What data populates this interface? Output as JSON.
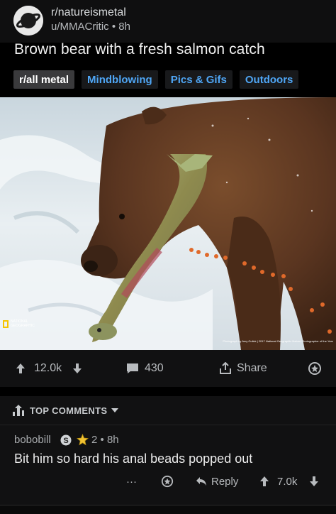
{
  "post": {
    "subreddit": "r/natureismetal",
    "author": "u/MMACritic",
    "age": "8h",
    "meta_separator": "•",
    "title": "Brown bear with a fresh salmon catch",
    "flairs": [
      "r/all metal",
      "Mindblowing",
      "Pics & Gifs",
      "Outdoors"
    ],
    "image": {
      "watermark_logo": "NATIONAL GEOGRAPHIC",
      "credit": "Photograph by Amy Gulick | 2017 National Geographic Nature Photographer of the Year"
    }
  },
  "actions": {
    "upvotes": "12.0k",
    "comments": "430",
    "share_label": "Share"
  },
  "comments_section": {
    "sort_label": "TOP COMMENTS"
  },
  "comment": {
    "author": "bobobill",
    "award_count": "2",
    "age": "8h",
    "meta_separator": "•",
    "body": "Bit him so hard his anal beads popped out",
    "reply_label": "Reply",
    "votes": "7.0k",
    "more_label": "···"
  },
  "colors": {
    "background": "#000000",
    "card": "#111112",
    "flair_link": "#4fa6f5",
    "text_primary": "#f0f0f0",
    "text_secondary": "#b8bbbe"
  }
}
